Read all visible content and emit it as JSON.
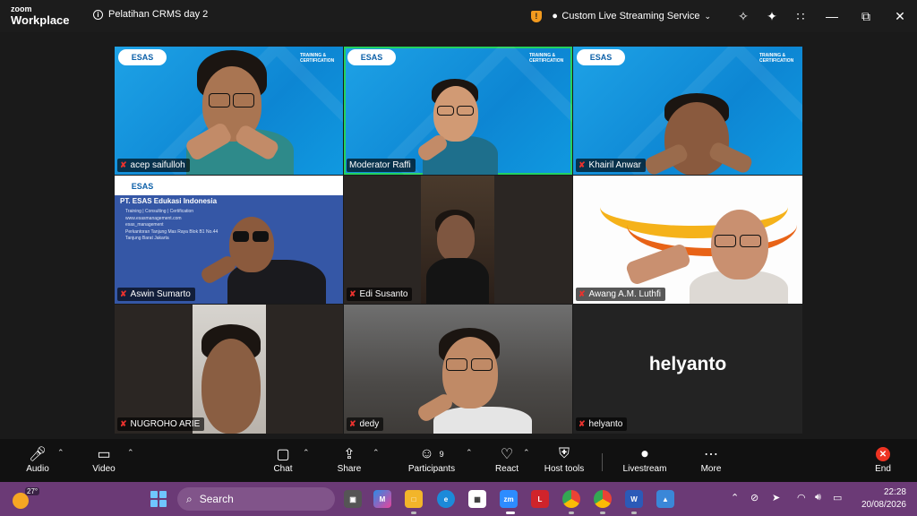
{
  "app": {
    "logo_line1": "zoom",
    "logo_line2": "Workplace",
    "meeting_title": "Pelatihan CRMS day 2",
    "live_service": "Custom Live Streaming Service"
  },
  "participants": [
    {
      "name": "acep saifulloh",
      "muted": true
    },
    {
      "name": "Moderator Raffi",
      "muted": false,
      "active_speaker": true
    },
    {
      "name": "Khairil Anwar",
      "muted": true
    },
    {
      "name": "Aswin Sumarto",
      "muted": true
    },
    {
      "name": "Edi Susanto",
      "muted": true
    },
    {
      "name": "Awang A.M. Luthfi",
      "muted": true
    },
    {
      "name": "NUGROHO ARIE",
      "muted": true
    },
    {
      "name": "dedy",
      "muted": true
    },
    {
      "name": "helyanto",
      "muted": true,
      "video_off": true
    }
  ],
  "slide": {
    "logo_text": "ESAS",
    "tc_text": "TRAINING & CERTIFICATION",
    "company": "PT. ESAS Edukasi Indonesia",
    "tagline": "Training | Consulting | Certification",
    "website": "www.esasmanagement.com",
    "social": "esas_management",
    "address": "Perkantoran Tanjung Mas Raya Blok B1 No.44 Tanjung Barat Jakarta"
  },
  "toolbar": {
    "audio": "Audio",
    "video": "Video",
    "chat": "Chat",
    "share": "Share",
    "participants": "Participants",
    "participants_count": "9",
    "react": "React",
    "host_tools": "Host tools",
    "livestream": "Livestream",
    "more": "More",
    "end": "End"
  },
  "taskbar": {
    "temperature": "27°",
    "search_placeholder": "Search",
    "time": "22:28",
    "date": "20/08/2026"
  },
  "colors": {
    "active_speaker": "#23d160",
    "muted": "#e8322e",
    "taskbar": "#6b3a76",
    "esas_blue": "#1ea2e6"
  }
}
